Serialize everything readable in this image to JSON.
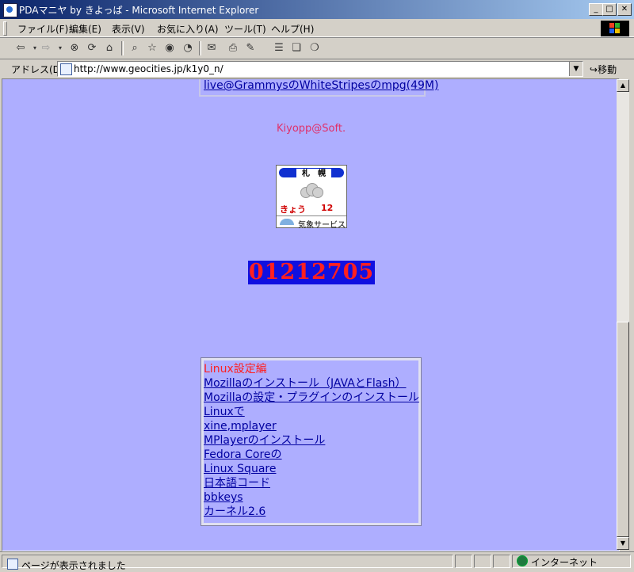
{
  "window": {
    "title": "PDAマニヤ by きよっぱ - Microsoft Internet Explorer",
    "minimize": "_",
    "maximize": "□",
    "close": "✕"
  },
  "menu": [
    "ファイル(F)",
    "編集(E)",
    "表示(V)",
    "お気に入り(A)",
    "ツール(T)",
    "ヘルプ(H)"
  ],
  "toolbar_icons": [
    "back-icon",
    "dropdown-icon",
    "forward-icon",
    "dropdown-icon",
    "stop-icon",
    "refresh-icon",
    "home-icon",
    "search-icon",
    "favorites-icon",
    "media-icon",
    "history-icon",
    "mail-icon",
    "print-icon",
    "edit-icon",
    "discuss-icon",
    "messenger-icon"
  ],
  "address": {
    "label": "アドレス(D)",
    "url": "http://www.geocities.jp/k1y0_n/",
    "go": "移動"
  },
  "page": {
    "top_link": "live@GrammysのWhiteStripesのmpg(49M)",
    "credit": "Kiyopp@Soft.",
    "weather": {
      "city": "札　幌",
      "day": "きょう",
      "temp": "12",
      "service": "気象サービス"
    },
    "counter": "01212705",
    "links_title": "Linux設定編",
    "links": [
      "Mozillaのインストール（JAVAとFlash）",
      "Mozillaの設定・プラグインのインストール",
      "Linuxで",
      "xine,mplayer",
      "MPlayerのインストール",
      "Fedora Coreの",
      "Linux Square",
      "日本語コード",
      "bbkeys",
      "カーネル2.6"
    ]
  },
  "status": {
    "text": "ページが表示されました",
    "zone": "インターネット"
  },
  "colors": {
    "page_bg": "#aeaeff",
    "link": "#0000a0",
    "heading_red": "#ff2020",
    "counter_bg": "#1010e0",
    "titlebar": "#0a246a"
  }
}
